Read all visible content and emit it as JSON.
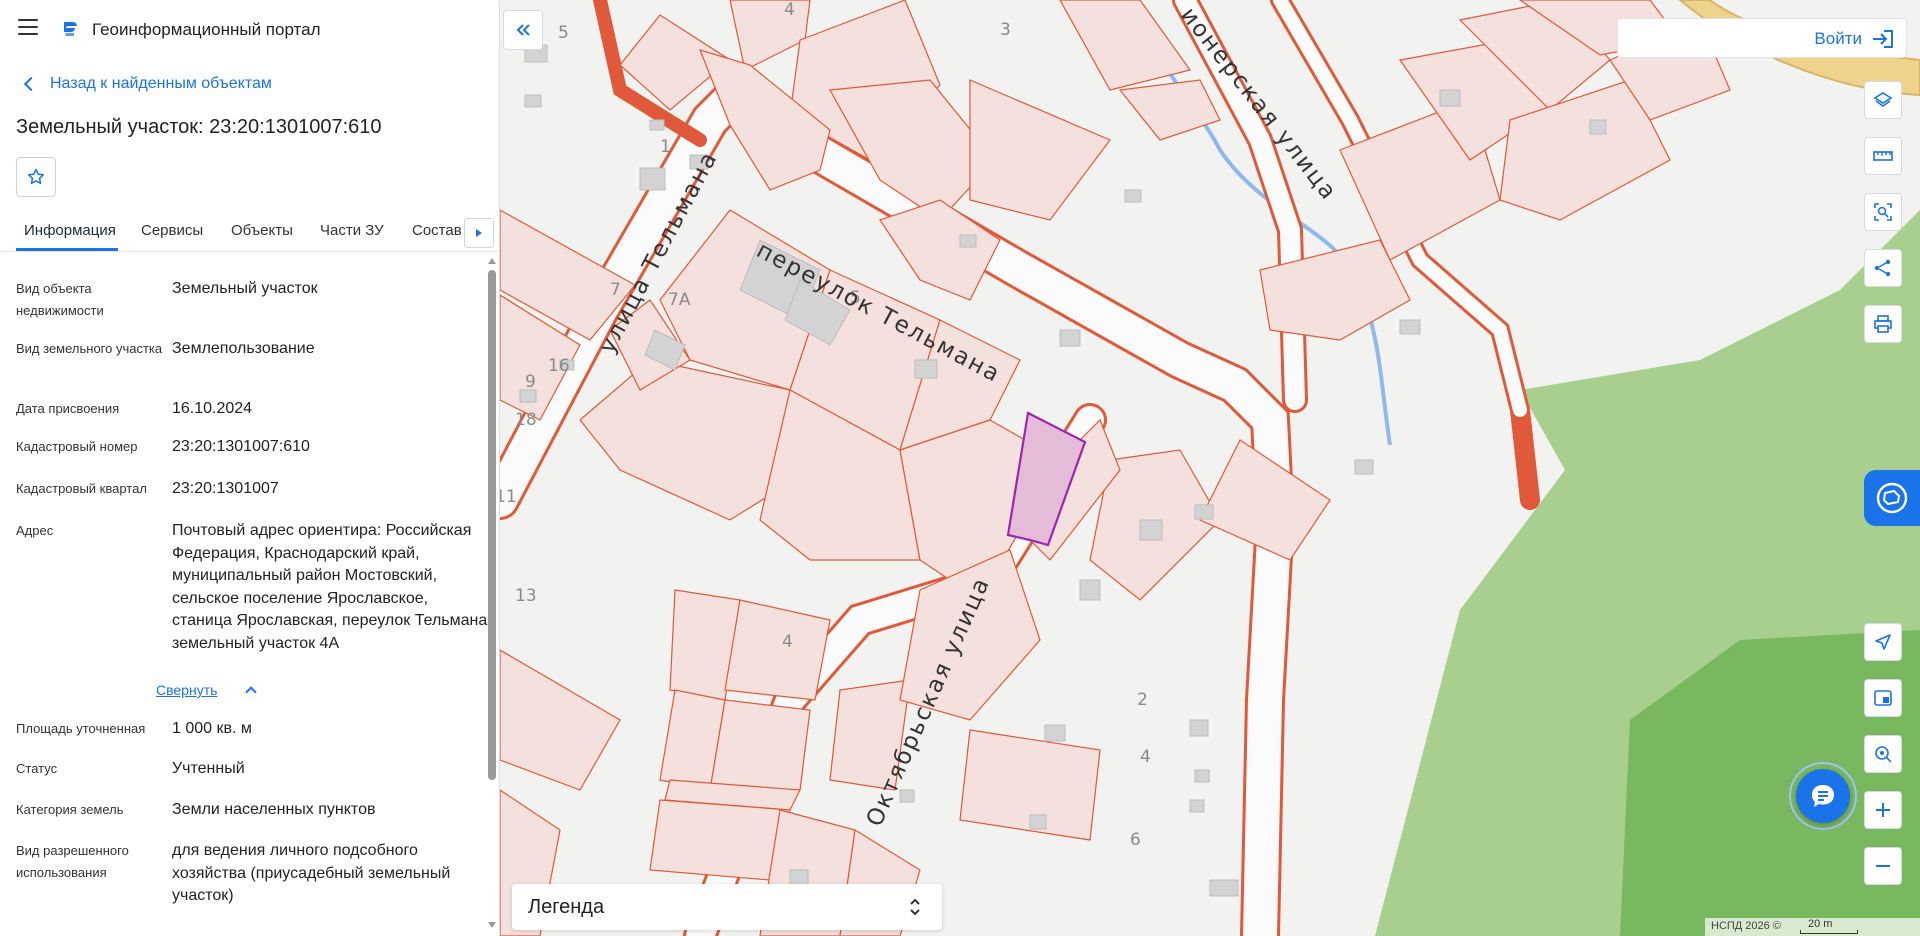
{
  "app": {
    "title": "Геоинформационный портал"
  },
  "panel": {
    "back_link": "Назад к найденным объектам",
    "object_title": "Земельный участок: 23:20:1301007:610",
    "tabs": [
      "Информация",
      "Сервисы",
      "Объекты",
      "Части ЗУ",
      "Состав"
    ],
    "active_tab": "Информация",
    "fields": [
      {
        "label": "Вид объекта недвижимости",
        "value": "Земельный участок"
      },
      {
        "label": "Вид земельного участка",
        "value": "Землепользование"
      },
      {
        "label": "Дата присвоения",
        "value": "16.10.2024"
      },
      {
        "label": "Кадастровый номер",
        "value": "23:20:1301007:610"
      },
      {
        "label": "Кадастровый квартал",
        "value": "23:20:1301007"
      },
      {
        "label": "Адрес",
        "value": "Почтовый адрес ориентира: Российская Федерация, Краснодарский край, муниципальный район Мостовский, сельское поселение Ярославское, станица Ярославская, переулок Тельмана, земельный участок 4А"
      },
      {
        "label": "Площадь уточненная",
        "value": "1 000 кв. м"
      },
      {
        "label": "Статус",
        "value": "Учтенный"
      },
      {
        "label": "Категория земель",
        "value": "Земли населенных пунктов"
      },
      {
        "label": "Вид разрешенного использования",
        "value": "для ведения личного подсобного хозяйства (приусадебный земельный участок)"
      }
    ],
    "collapse_label": "Свернуть"
  },
  "map": {
    "login_label": "Войти",
    "legend_label": "Легенда",
    "attribution": "НСПД 2026 ©",
    "scale_label": "20 m",
    "streets": {
      "telmana_street": "улица Тельмана",
      "telmana_lane": "переулок Тельмана",
      "oktyabrskaya": "Октябрьская улица",
      "pionerskaya": "ионерская улица"
    },
    "house_numbers": [
      "5",
      "4",
      "3",
      "1",
      "7",
      "7А",
      "5",
      "16",
      "9",
      "18",
      "11",
      "13",
      "4",
      "2",
      "4",
      "6"
    ],
    "tools": [
      "layers-icon",
      "ruler-icon",
      "select-area-icon",
      "share-icon",
      "print-icon",
      "locate-icon",
      "minimap-icon",
      "geo-search-icon",
      "zoom-in-icon",
      "zoom-out-icon"
    ],
    "colors": {
      "parcel_fill": "#f4e0dc",
      "parcel_stroke": "#e0593a",
      "selected_fill": "#e5bcd8",
      "selected_stroke": "#9b27af",
      "forest": "#a8cf8e",
      "forest_dark": "#78b85e",
      "water": "#8fb9ee",
      "accent": "#1a73e8"
    }
  }
}
